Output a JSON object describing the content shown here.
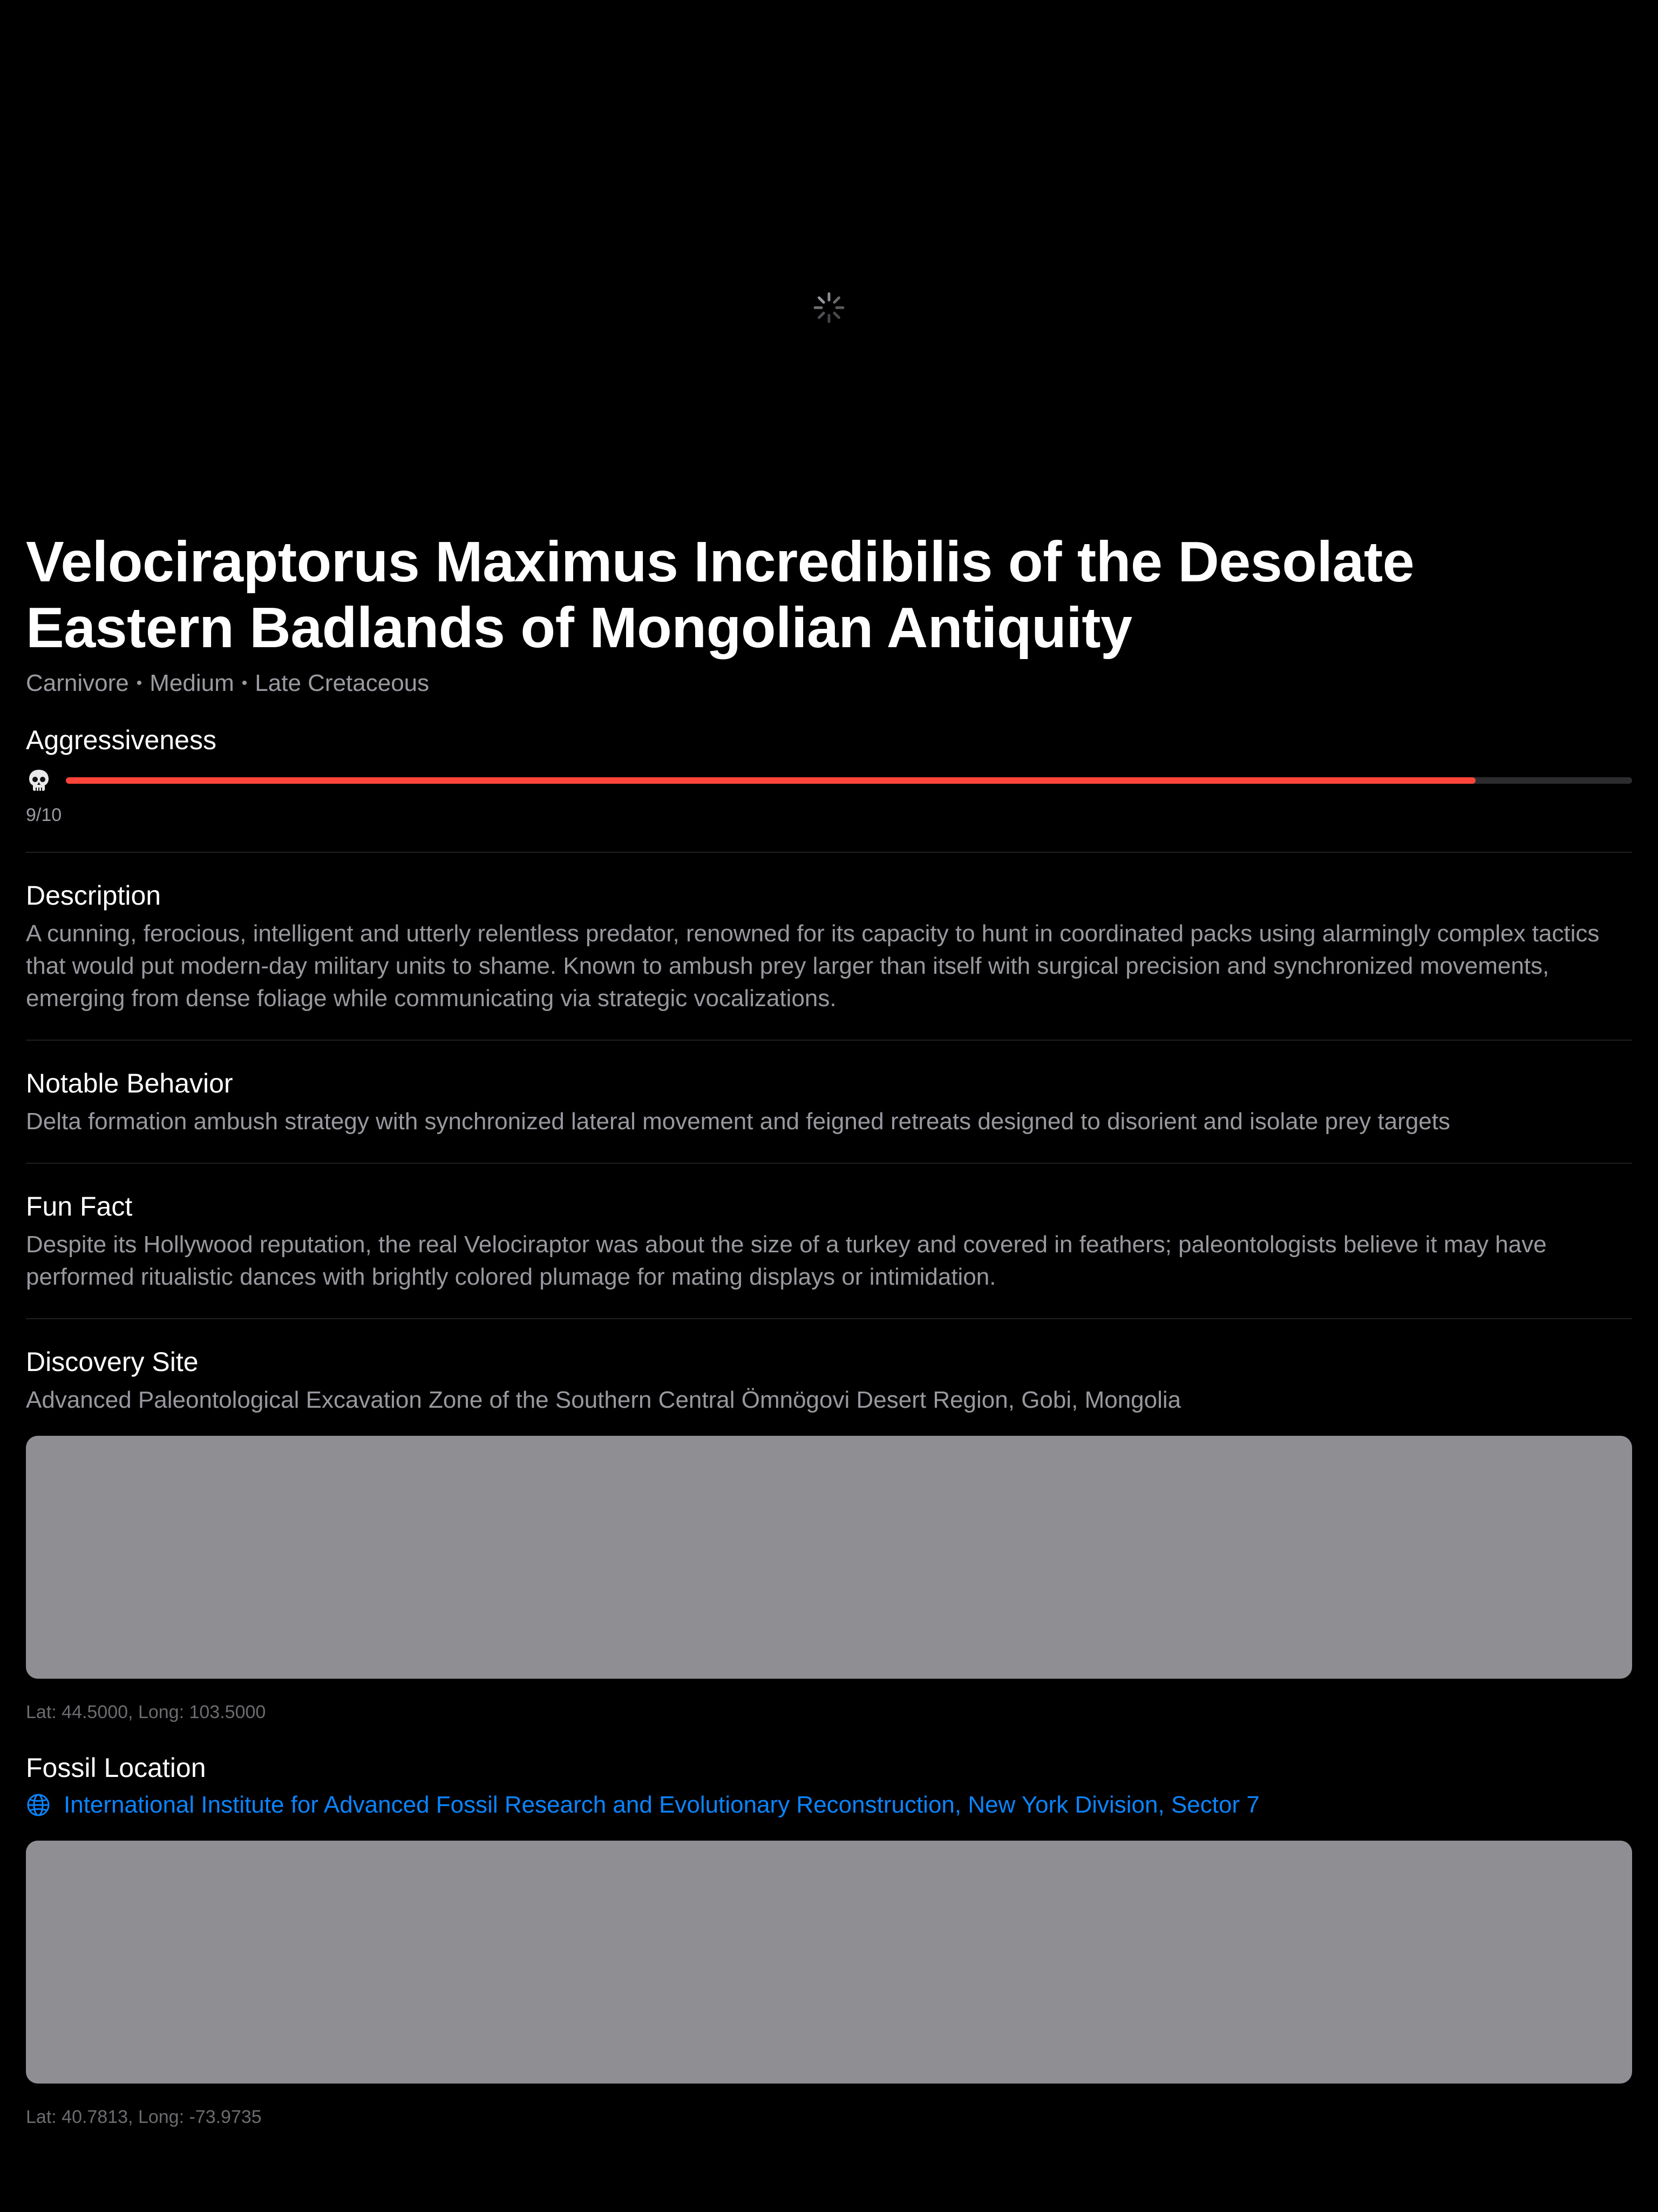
{
  "hero": {
    "loading_icon": "activity-spinner-icon"
  },
  "dino": {
    "title": "Velociraptorus Maximus Incredibilis of the Desolate Eastern Badlands of Mongolian Antiquity",
    "diet": "Carnivore",
    "size": "Medium",
    "period": "Late Cretaceous",
    "separator": "•"
  },
  "aggressiveness": {
    "heading": "Aggressiveness",
    "icon": "skull-icon",
    "value": 9,
    "max": 10,
    "score_text": "9/10",
    "bar_color": "#ff453a"
  },
  "description": {
    "heading": "Description",
    "text": "A cunning, ferocious, intelligent and utterly relentless predator, renowned for its capacity to hunt in coordinated packs using alarmingly complex tactics that would put modern-day military units to shame. Known to ambush prey larger than itself with surgical precision and synchronized movements, emerging from dense foliage while communicating via strategic vocalizations."
  },
  "behavior": {
    "heading": "Notable Behavior",
    "text": "Delta formation ambush strategy with synchronized lateral movement and feigned retreats designed to disorient and isolate prey targets"
  },
  "fun_fact": {
    "heading": "Fun Fact",
    "text": "Despite its Hollywood reputation, the real Velociraptor was about the size of a turkey and covered in feathers; paleontologists believe it may have performed ritualistic dances with brightly colored plumage for mating displays or intimidation."
  },
  "discovery": {
    "heading": "Discovery Site",
    "text": "Advanced Paleontological Excavation Zone of the Southern Central Ömnögovi Desert Region, Gobi, Mongolia",
    "coords": "Lat: 44.5000, Long: 103.5000"
  },
  "fossil": {
    "heading": "Fossil Location",
    "icon": "globe-icon",
    "link_text": "International Institute for Advanced Fossil Research and Evolutionary Reconstruction, New York Division, Sector 7",
    "coords": "Lat: 40.7813, Long: -73.9735",
    "link_color": "#0a84ff"
  },
  "colors": {
    "background": "#000000",
    "map_placeholder": "#8e8e93",
    "secondary_text": "#98989e"
  }
}
